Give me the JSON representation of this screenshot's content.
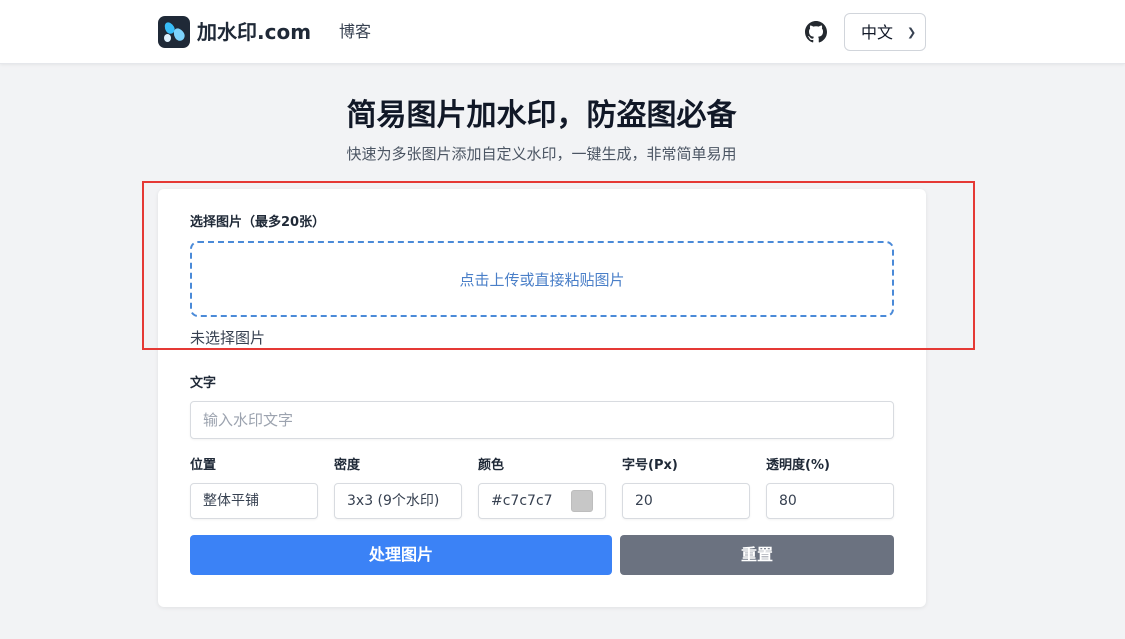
{
  "header": {
    "brand": "加水印.com",
    "nav_blog": "博客",
    "language": "中文",
    "icons": {
      "logo": "water-drops-logo",
      "github": "github-icon",
      "chevron": "chevron-down-icon"
    }
  },
  "hero": {
    "title": "简易图片加水印，防盗图必备",
    "subtitle": "快速为多张图片添加自定义水印，一键生成，非常简单易用"
  },
  "form": {
    "images_label": "选择图片（最多20张）",
    "dropzone_text": "点击上传或直接粘贴图片",
    "no_image_text": "未选择图片",
    "text_label": "文字",
    "text_placeholder": "输入水印文字",
    "position_label": "位置",
    "position_value": "整体平铺",
    "density_label": "密度",
    "density_value": "3x3 (9个水印)",
    "color_label": "颜色",
    "color_value": "#c7c7c7",
    "fontsize_label": "字号(Px)",
    "fontsize_value": "20",
    "opacity_label": "透明度(%)",
    "opacity_value": "80",
    "process_button": "处理图片",
    "reset_button": "重置"
  },
  "colors": {
    "primary": "#3b82f6",
    "reset": "#6b7280",
    "dropzone_border": "#4a8ad8",
    "highlight": "#e53935",
    "swatch": "#c7c7c7"
  }
}
